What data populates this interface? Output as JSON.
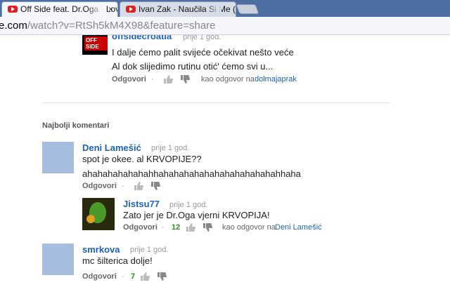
{
  "tabs": [
    {
      "title": "Off Side feat. Dr.Oga - Lov",
      "close": "×"
    },
    {
      "title": "Ivan Zak - Naučila Si Me (("
    }
  ],
  "url": {
    "domain": "e.com",
    "path": "/watch?v=RtSh5kM4X98&feature=share"
  },
  "top_reply": {
    "author": "offsidecroatia",
    "time": "prije 1 god.",
    "line1": "I dalje ćemo palit svijeće očekivat nešto veće",
    "line2": "Al dok slijedimo rutinu otić' ćemo svi u...",
    "reply_label": "Odgovori",
    "reply_to_prefix": "kao odgovor na",
    "reply_to": "dolmajaprak"
  },
  "section_title": "Najbolji komentari",
  "comments": [
    {
      "author": "Deni Lamešić",
      "time": "prije 1 god.",
      "line1": "spot je okee. al KRVOPIJE??",
      "line2": "ahahahahahahahhahahahahahahahahahahahahhaha",
      "reply_label": "Odgovori"
    },
    {
      "author": "Jistsu77",
      "time": "prije 1 god.",
      "line1": "Zato jer je Dr.Oga vjerni KRVOPIJA!",
      "reply_label": "Odgovori",
      "score": "12",
      "reply_to_prefix": "kao odgovor na",
      "reply_to": "Deni Lamešić"
    },
    {
      "author": "smrkova",
      "time": "prije 1 god.",
      "line1": "mc šilterica dolje!",
      "reply_label": "Odgovori",
      "score": "7"
    }
  ],
  "offside_logo_text": "OFF SIDE",
  "separator": "·",
  "colors": {
    "link": "#1c62b9",
    "score": "#2e8b1f",
    "tabbar": "#4d6ea3",
    "avatar": "#a6bde0"
  }
}
